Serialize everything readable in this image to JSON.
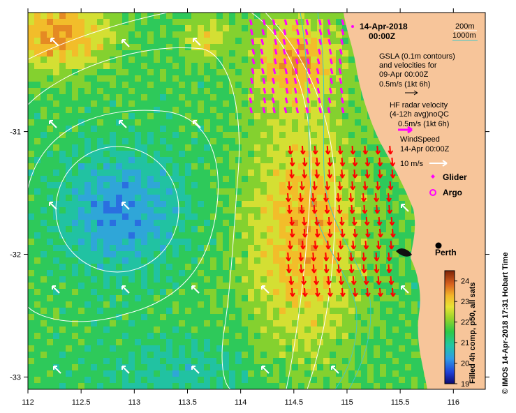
{
  "header": {
    "date": "14-Apr-2018",
    "time": "00:00Z"
  },
  "depth_legend": {
    "line1": "200m",
    "line2": "1000m"
  },
  "gsla_legend": {
    "line1": "GSLA (0.1m contours)",
    "line2": "and velocities for",
    "line3": "09-Apr 00:00Z",
    "scale": "0.5m/s (1kt 6h)"
  },
  "hf_legend": {
    "line1": "HF radar velocity",
    "line2": "(4-12h avg)noQC",
    "scale": "0.5m/s (1kt 6h)"
  },
  "wind_legend": {
    "line1": "WindSpeed",
    "line2": "14-Apr 00:00Z",
    "scale": "10 m/s"
  },
  "markers": {
    "glider": "Glider",
    "argo": "Argo"
  },
  "city": {
    "name": "Perth"
  },
  "colorbar": {
    "title": "Filled 4h comp, p50, all sats",
    "ticks": [
      "24",
      "23",
      "22",
      "21",
      "20",
      "19"
    ],
    "min": 19,
    "max": 24.5
  },
  "credit": "© IMOS 14-Apr-2018 17:31 Hobart Time",
  "axes": {
    "x_ticks": [
      "112",
      "112.5",
      "113",
      "113.5",
      "114",
      "114.5",
      "115",
      "115.5",
      "116"
    ],
    "y_ticks": [
      "-31",
      "-32",
      "-33"
    ],
    "x_range": [
      112,
      116.3
    ],
    "y_range": [
      -33.1,
      -30.03
    ]
  },
  "colors": {
    "land": "#f7c59a",
    "hf_arrow": "#ff00ff",
    "gsla_arrow": "#000000",
    "red_arrow": "#ff0000",
    "wind_arrow": "#ffffff",
    "isobath": "#40c8c8"
  }
}
